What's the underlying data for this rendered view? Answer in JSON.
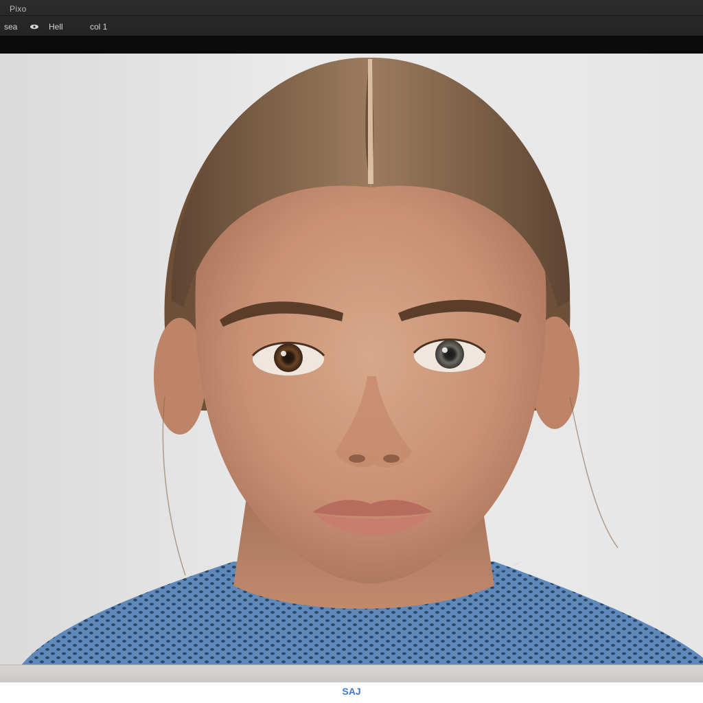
{
  "window": {
    "title": "Pixo"
  },
  "toolbar": {
    "items": [
      {
        "label": "sea"
      },
      {
        "label": "Hell"
      },
      {
        "label": "col 1"
      }
    ]
  },
  "footer": {
    "label": "SAJ"
  },
  "colors": {
    "appbar": "#262626",
    "canvas_bg": "#e6e6e6",
    "sweater": "#5b84b4",
    "hair": "#7a5a3f",
    "footer_accent": "#3f78c9"
  }
}
